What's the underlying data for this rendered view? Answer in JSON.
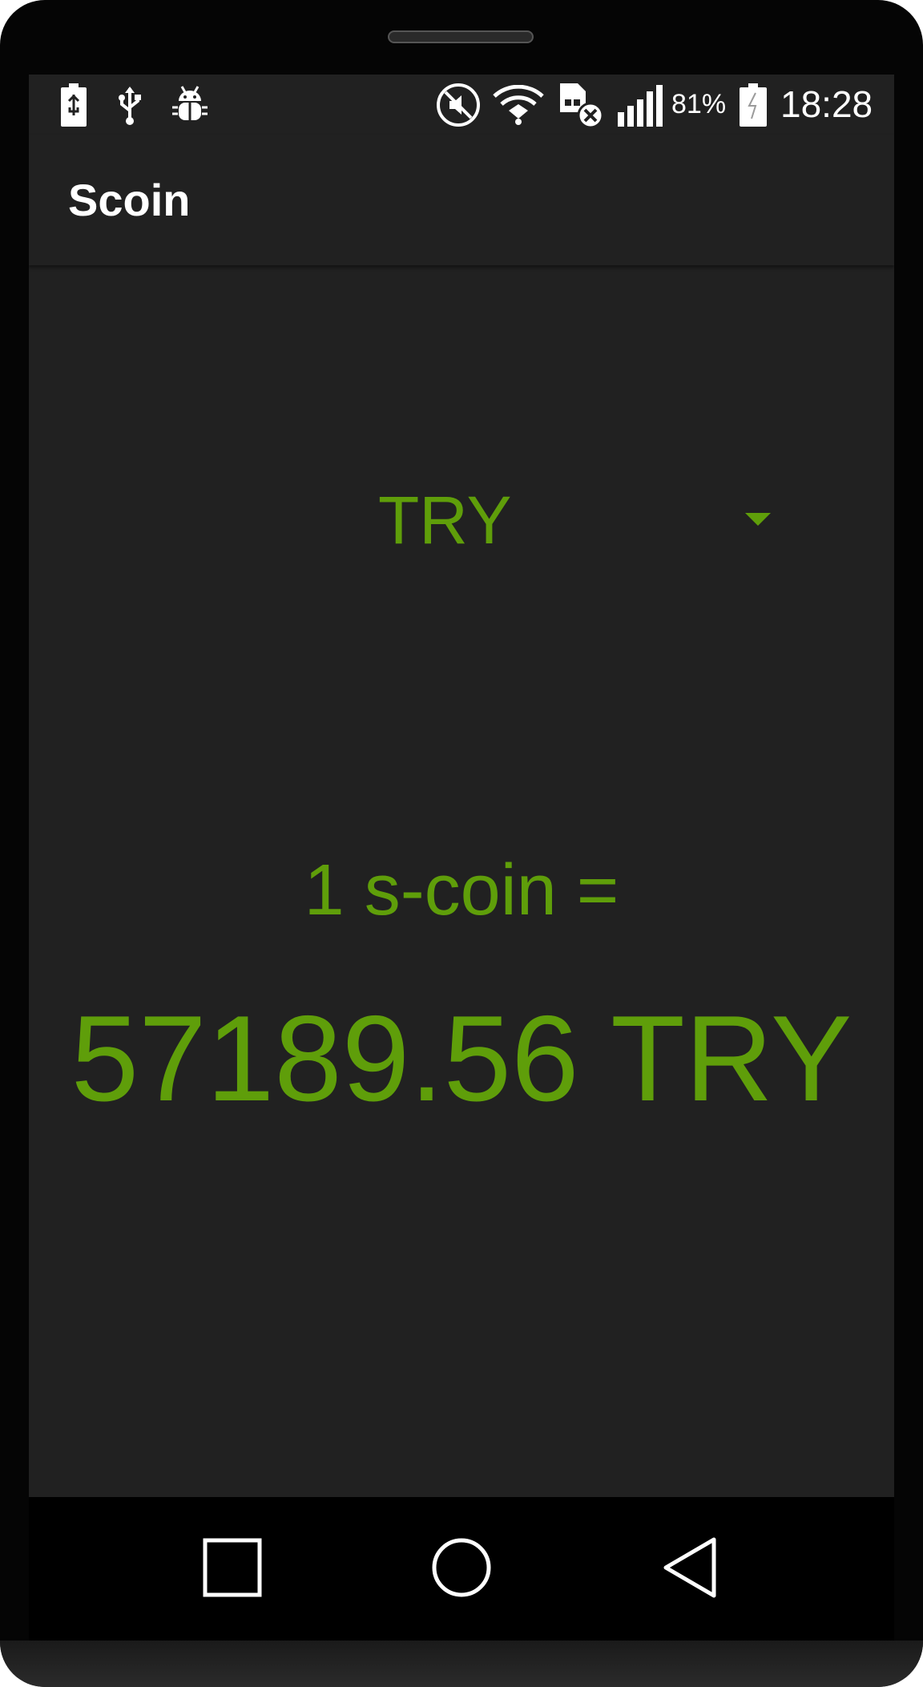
{
  "status_bar": {
    "battery_percent": "81%",
    "time": "18:28",
    "left_icons": [
      "battery-charging-icon",
      "usb-icon",
      "android-debug-icon"
    ],
    "right_icons": [
      "mute-icon",
      "wifi-icon",
      "no-sim-icon",
      "signal-icon",
      "battery-icon"
    ]
  },
  "app_bar": {
    "title": "Scoin"
  },
  "currency_selector": {
    "selected": "TRY"
  },
  "rate": {
    "label": "1 s-coin =",
    "value": "57189.56 TRY"
  },
  "navigation": {
    "icons": [
      "recent-apps-icon",
      "home-icon",
      "back-icon"
    ]
  },
  "colors": {
    "accent": "#5f9e0a",
    "background": "#212121",
    "text": "#ffffff"
  }
}
